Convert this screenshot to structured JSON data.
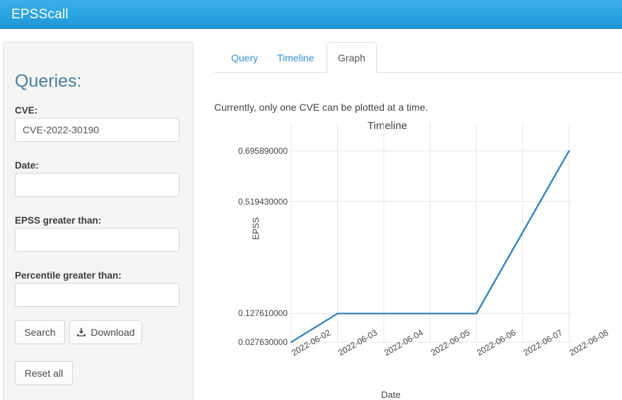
{
  "navbar": {
    "brand": "EPSScall"
  },
  "sidebar": {
    "title": "Queries:",
    "fields": [
      {
        "label": "CVE:",
        "value": "CVE-2022-30190",
        "placeholder": ""
      },
      {
        "label": "Date:",
        "value": "",
        "placeholder": ""
      },
      {
        "label": "EPSS greater than:",
        "value": "",
        "placeholder": ""
      },
      {
        "label": "Percentile greater than:",
        "value": "",
        "placeholder": ""
      }
    ],
    "buttons": {
      "search": "Search",
      "download": "Download",
      "download_icon": "download-icon",
      "reset": "Reset all"
    }
  },
  "tabs": [
    {
      "label": "Query",
      "active": false
    },
    {
      "label": "Timeline",
      "active": false
    },
    {
      "label": "Graph",
      "active": true
    }
  ],
  "main": {
    "notice": "Currently, only one CVE can be plotted at a time."
  },
  "chart_data": {
    "type": "line",
    "title": "Timeline",
    "xlabel": "Date",
    "ylabel": "EPSS",
    "grid": true,
    "legend": false,
    "x": [
      "2022-06-02",
      "2022-06-03",
      "2022-06-04",
      "2022-06-05",
      "2022-06-06",
      "2022-06-07",
      "2022-06-08"
    ],
    "categories": [
      "2022-06-02",
      "2022-06-03",
      "2022-06-04",
      "2022-06-05",
      "2022-06-06",
      "2022-06-07",
      "2022-06-08"
    ],
    "values": [
      0.02763,
      0.12761,
      0.12761,
      0.12761,
      0.12761,
      0.41175,
      0.69589
    ],
    "series": [
      {
        "name": "CVE-2022-30190",
        "values": [
          0.02763,
          0.12761,
          0.12761,
          0.12761,
          0.12761,
          0.41175,
          0.69589
        ],
        "color": "#2b7cb3"
      }
    ],
    "ytick_labels": [
      "0.695890000",
      "0.519430000",
      "0.127610000",
      "0.027630000"
    ],
    "ytick_values": [
      0.69589,
      0.51943,
      0.12761,
      0.02763
    ],
    "xtick_labels": [
      "2022-06-02",
      "2022-06-03",
      "2022-06-04",
      "2022-06-05",
      "2022-06-06",
      "2022-06-07",
      "2022-06-08"
    ],
    "ylim": [
      0.02763,
      0.69589
    ],
    "line_color": "#2b7cb3",
    "grid_color": "#e6e6e6"
  }
}
